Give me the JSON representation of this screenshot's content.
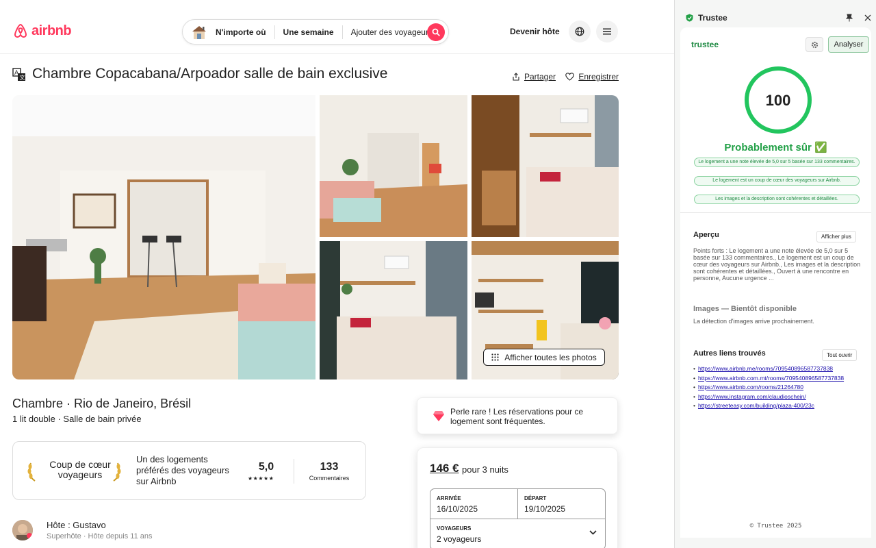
{
  "airbnb": {
    "logo_text": "airbnb",
    "search": {
      "where": "N'importe où",
      "when": "Une semaine",
      "who": "Ajouter des voyageurs"
    },
    "host_link": "Devenir hôte",
    "listing_title": "Chambre Copacabana/Arpoador salle de bain exclusive",
    "share_label": "Partager",
    "save_label": "Enregistrer",
    "show_all_photos": "Afficher toutes les photos",
    "room_title": "Chambre · Rio de Janeiro, Brésil",
    "room_subtitle": "1 lit double · Salle de bain privée",
    "guest_favorite": {
      "title": "Coup de cœur voyageurs",
      "description": "Un des logements préférés des voyageurs sur Airbnb",
      "rating": "5,0",
      "stars": "★★★★★",
      "review_count": "133",
      "review_label": "Commentaires"
    },
    "host": {
      "name": "Hôte : Gustavo",
      "subtitle": "Superhôte · Hôte depuis 11 ans"
    },
    "rare_find": "Perle rare ! Les réservations pour ce logement sont fréquentes.",
    "booking": {
      "price": "146 €",
      "price_suffix": "pour 3 nuits",
      "checkin_label": "ARRIVÉE",
      "checkin_value": "16/10/2025",
      "checkout_label": "DÉPART",
      "checkout_value": "19/10/2025",
      "guests_label": "VOYAGEURS",
      "guests_value": "2 voyageurs"
    }
  },
  "trustee": {
    "panel_title": "Trustee",
    "logo_text": "trustee",
    "analyze_label": "Analyser",
    "score": "100",
    "verdict": "Probablement sûr ✅",
    "chips": [
      "Le logement a une note élevée de 5,0 sur 5 basée sur 133 commentaires.",
      "Le logement est un coup de cœur des voyageurs sur Airbnb.",
      "Les images et la description sont cohérentes et détaillées."
    ],
    "overview": {
      "title": "Aperçu",
      "button": "Afficher plus",
      "text": "Points forts : Le logement a une note élevée de 5,0 sur 5 basée sur 133 commentaires., Le logement est un coup de cœur des voyageurs sur Airbnb., Les images et la description sont cohérentes et détaillées., Ouvert à une rencontre en personne, Aucune urgence ..."
    },
    "images": {
      "title": "Images — Bientôt disponible",
      "text": "La détection d'images arrive prochainement."
    },
    "links": {
      "title": "Autres liens trouvés",
      "button": "Tout ouvrir",
      "items": [
        "https://www.airbnb.me/rooms/709540896587737838",
        "https://www.airbnb.com.mt/rooms/709540896587737838",
        "https://www.airbnb.com/rooms/21264780",
        "https://www.instagram.com/claudioschein/",
        "https://streeteasy.com/building/plaza-400/23c"
      ]
    },
    "footer": "© Trustee 2025"
  },
  "colors": {
    "airbnb_brand": "#ff385c",
    "trustee_green": "#22c55e"
  }
}
